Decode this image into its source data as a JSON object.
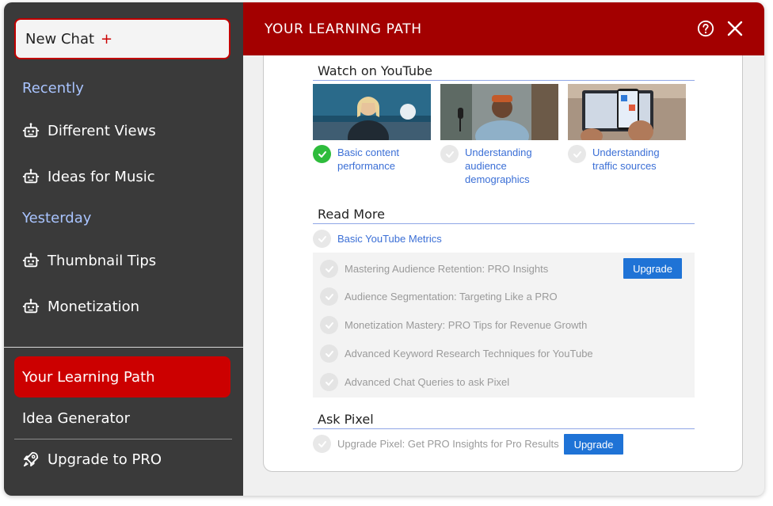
{
  "sidebar": {
    "new_chat": "New Chat",
    "new_chat_plus": "+",
    "recently_label": "Recently",
    "recent_items": [
      "Different Views",
      "Ideas for Music"
    ],
    "yesterday_label": "Yesterday",
    "yesterday_items": [
      "Thumbnail Tips",
      "Monetization"
    ],
    "learning_path": "Your Learning Path",
    "idea_generator": "Idea Generator",
    "upgrade": "Upgrade to PRO"
  },
  "header": {
    "title": "YOUR LEARNING PATH",
    "help_icon": "question-circle-icon",
    "close_icon": "close-icon"
  },
  "youtube": {
    "title": "Watch on YouTube",
    "videos": [
      {
        "label": "Basic content performance",
        "done": true
      },
      {
        "label": "Understanding audience demographics",
        "done": false
      },
      {
        "label": "Understanding traffic sources",
        "done": false
      }
    ]
  },
  "read_more": {
    "title": "Read More",
    "free_item": "Basic YouTube Metrics",
    "pro_items": [
      "Mastering Audience Retention: PRO Insights",
      "Audience Segmentation: Targeting Like a PRO",
      "Monetization Mastery: PRO Tips for Revenue Growth",
      "Advanced Keyword Research Techniques for YouTube",
      "Advanced Chat Queries to ask Pixel"
    ],
    "upgrade_label": "Upgrade"
  },
  "ask_pixel": {
    "title": "Ask Pixel",
    "item": "Upgrade Pixel: Get PRO Insights for Pro Results",
    "upgrade_label": "Upgrade"
  },
  "colors": {
    "header": "#a30000",
    "active": "#cc0000",
    "link": "#3b6fd6",
    "upgrade": "#1f73d6",
    "done": "#2ebc3c"
  }
}
